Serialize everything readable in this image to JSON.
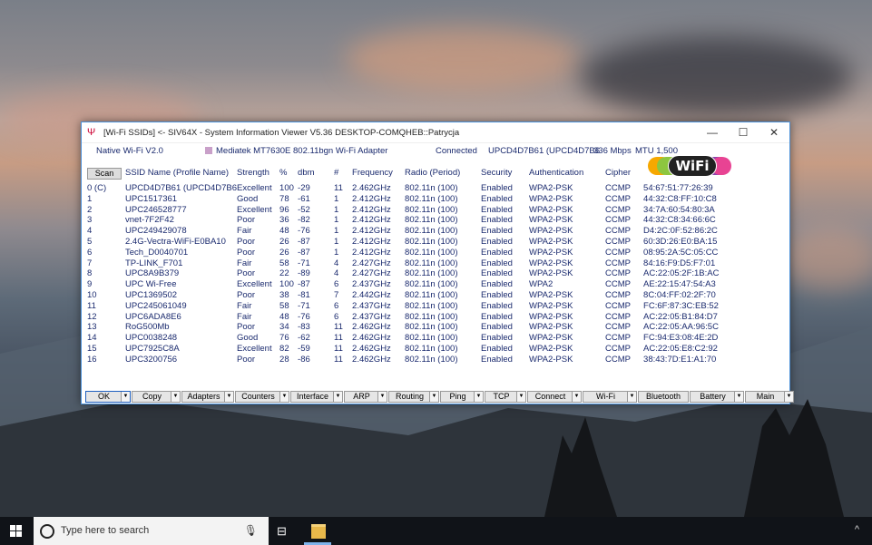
{
  "window": {
    "title": "[Wi-Fi SSIDs] <- SIV64X - System Information Viewer V5.36 DESKTOP-COMQHEB::Patrycja",
    "minimize": "—",
    "maximize": "☐",
    "close": "✕"
  },
  "info": {
    "api": "Native Wi-Fi V2.0",
    "adapter": "Mediatek MT7630E 802.11bgn Wi-Fi Adapter",
    "status": "Connected",
    "connection": "UPCD4D7B61 (UPCD4D7B6",
    "speed": "336 Mbps",
    "mtu": "MTU 1,500"
  },
  "scan_label": "Scan",
  "logo": {
    "text": "WiFi",
    "colors": [
      "#f6a800",
      "#8dc63f",
      "#ed1c24",
      "#8e44ad",
      "#e84393"
    ]
  },
  "columns": [
    "SSID Name (Profile Name)",
    "Strength",
    "%",
    "dbm",
    "#",
    "Frequency",
    "Radio (Period)",
    "Security",
    "Authentication",
    "Cipher",
    ""
  ],
  "rows": [
    {
      "n": "0 (C)",
      "ssid": "UPCD4D7B61 (UPCD4D7B6",
      "str": "Excellent",
      "pct": "100",
      "dbm": "-29",
      "ch": "11",
      "freq": "2.462GHz",
      "radio": "802.11n (100)",
      "sec": "Enabled",
      "auth": "WPA2-PSK",
      "ciph": "CCMP",
      "mac": "54:67:51:77:26:39"
    },
    {
      "n": "1",
      "ssid": "UPC1517361",
      "str": "Good",
      "pct": "78",
      "dbm": "-61",
      "ch": "1",
      "freq": "2.412GHz",
      "radio": "802.11n (100)",
      "sec": "Enabled",
      "auth": "WPA2-PSK",
      "ciph": "CCMP",
      "mac": "44:32:C8:FF:10:C8"
    },
    {
      "n": "2",
      "ssid": "UPC246528777",
      "str": "Excellent",
      "pct": "96",
      "dbm": "-52",
      "ch": "1",
      "freq": "2.412GHz",
      "radio": "802.11n (100)",
      "sec": "Enabled",
      "auth": "WPA2-PSK",
      "ciph": "CCMP",
      "mac": "34:7A:60:54:80:3A"
    },
    {
      "n": "3",
      "ssid": "vnet-7F2F42",
      "str": "Poor",
      "pct": "36",
      "dbm": "-82",
      "ch": "1",
      "freq": "2.412GHz",
      "radio": "802.11n (100)",
      "sec": "Enabled",
      "auth": "WPA2-PSK",
      "ciph": "CCMP",
      "mac": "44:32:C8:34:66:6C"
    },
    {
      "n": "4",
      "ssid": "UPC249429078",
      "str": "Fair",
      "pct": "48",
      "dbm": "-76",
      "ch": "1",
      "freq": "2.412GHz",
      "radio": "802.11n (100)",
      "sec": "Enabled",
      "auth": "WPA2-PSK",
      "ciph": "CCMP",
      "mac": "D4:2C:0F:52:86:2C"
    },
    {
      "n": "5",
      "ssid": "2.4G-Vectra-WiFi-E0BA10",
      "str": "Poor",
      "pct": "26",
      "dbm": "-87",
      "ch": "1",
      "freq": "2.412GHz",
      "radio": "802.11n (100)",
      "sec": "Enabled",
      "auth": "WPA2-PSK",
      "ciph": "CCMP",
      "mac": "60:3D:26:E0:BA:15"
    },
    {
      "n": "6",
      "ssid": "Tech_D0040701",
      "str": "Poor",
      "pct": "26",
      "dbm": "-87",
      "ch": "1",
      "freq": "2.412GHz",
      "radio": "802.11n (100)",
      "sec": "Enabled",
      "auth": "WPA2-PSK",
      "ciph": "CCMP",
      "mac": "08:95:2A:5C:05:CC"
    },
    {
      "n": "7",
      "ssid": "TP-LINK_F701",
      "str": "Fair",
      "pct": "58",
      "dbm": "-71",
      "ch": "4",
      "freq": "2.427GHz",
      "radio": "802.11n (100)",
      "sec": "Enabled",
      "auth": "WPA2-PSK",
      "ciph": "CCMP",
      "mac": "84:16:F9:D5:F7:01"
    },
    {
      "n": "8",
      "ssid": "UPC8A9B379",
      "str": "Poor",
      "pct": "22",
      "dbm": "-89",
      "ch": "4",
      "freq": "2.427GHz",
      "radio": "802.11n (100)",
      "sec": "Enabled",
      "auth": "WPA2-PSK",
      "ciph": "CCMP",
      "mac": "AC:22:05:2F:1B:AC"
    },
    {
      "n": "9",
      "ssid": "UPC Wi-Free",
      "str": "Excellent",
      "pct": "100",
      "dbm": "-87",
      "ch": "6",
      "freq": "2.437GHz",
      "radio": "802.11n (100)",
      "sec": "Enabled",
      "auth": "WPA2",
      "ciph": "CCMP",
      "mac": "AE:22:15:47:54:A3"
    },
    {
      "n": "10",
      "ssid": "UPC1369502",
      "str": "Poor",
      "pct": "38",
      "dbm": "-81",
      "ch": "7",
      "freq": "2.442GHz",
      "radio": "802.11n (100)",
      "sec": "Enabled",
      "auth": "WPA2-PSK",
      "ciph": "CCMP",
      "mac": "8C:04:FF:02:2F:70"
    },
    {
      "n": "11",
      "ssid": "UPC245061049",
      "str": "Fair",
      "pct": "58",
      "dbm": "-71",
      "ch": "6",
      "freq": "2.437GHz",
      "radio": "802.11n (100)",
      "sec": "Enabled",
      "auth": "WPA2-PSK",
      "ciph": "CCMP",
      "mac": "FC:6F:87:3C:EB:52"
    },
    {
      "n": "12",
      "ssid": "UPC6ADA8E6",
      "str": "Fair",
      "pct": "48",
      "dbm": "-76",
      "ch": "6",
      "freq": "2.437GHz",
      "radio": "802.11n (100)",
      "sec": "Enabled",
      "auth": "WPA2-PSK",
      "ciph": "CCMP",
      "mac": "AC:22:05:B1:84:D7"
    },
    {
      "n": "13",
      "ssid": "RoG500Mb",
      "str": "Poor",
      "pct": "34",
      "dbm": "-83",
      "ch": "11",
      "freq": "2.462GHz",
      "radio": "802.11n (100)",
      "sec": "Enabled",
      "auth": "WPA2-PSK",
      "ciph": "CCMP",
      "mac": "AC:22:05:AA:96:5C"
    },
    {
      "n": "14",
      "ssid": "UPC0038248",
      "str": "Good",
      "pct": "76",
      "dbm": "-62",
      "ch": "11",
      "freq": "2.462GHz",
      "radio": "802.11n (100)",
      "sec": "Enabled",
      "auth": "WPA2-PSK",
      "ciph": "CCMP",
      "mac": "FC:94:E3:08:4E:2D"
    },
    {
      "n": "15",
      "ssid": "UPC7925C8A",
      "str": "Excellent",
      "pct": "82",
      "dbm": "-59",
      "ch": "11",
      "freq": "2.462GHz",
      "radio": "802.11n (100)",
      "sec": "Enabled",
      "auth": "WPA2-PSK",
      "ciph": "CCMP",
      "mac": "AC:22:05:E8:C2:92"
    },
    {
      "n": "16",
      "ssid": "UPC3200756",
      "str": "Poor",
      "pct": "28",
      "dbm": "-86",
      "ch": "11",
      "freq": "2.462GHz",
      "radio": "802.11n (100)",
      "sec": "Enabled",
      "auth": "WPA2-PSK",
      "ciph": "CCMP",
      "mac": "38:43:7D:E1:A1:70"
    }
  ],
  "buttons": [
    {
      "label": "OK",
      "dd": true
    },
    {
      "label": "Copy",
      "dd": true
    },
    {
      "label": "Adapters",
      "dd": true
    },
    {
      "label": "Counters",
      "dd": true
    },
    {
      "label": "Interface",
      "dd": true
    },
    {
      "label": "ARP",
      "dd": true
    },
    {
      "label": "Routing",
      "dd": true
    },
    {
      "label": "Ping",
      "dd": true
    },
    {
      "label": "TCP",
      "dd": true
    },
    {
      "label": "Connect",
      "dd": true
    },
    {
      "label": "Wi-Fi",
      "dd": true
    },
    {
      "label": "Bluetooth",
      "dd": false
    },
    {
      "label": "Battery",
      "dd": true
    },
    {
      "label": "Main",
      "dd": true
    }
  ],
  "taskbar": {
    "search_placeholder": "Type here to search",
    "start_icon": "windows-logo",
    "tray": "^"
  }
}
